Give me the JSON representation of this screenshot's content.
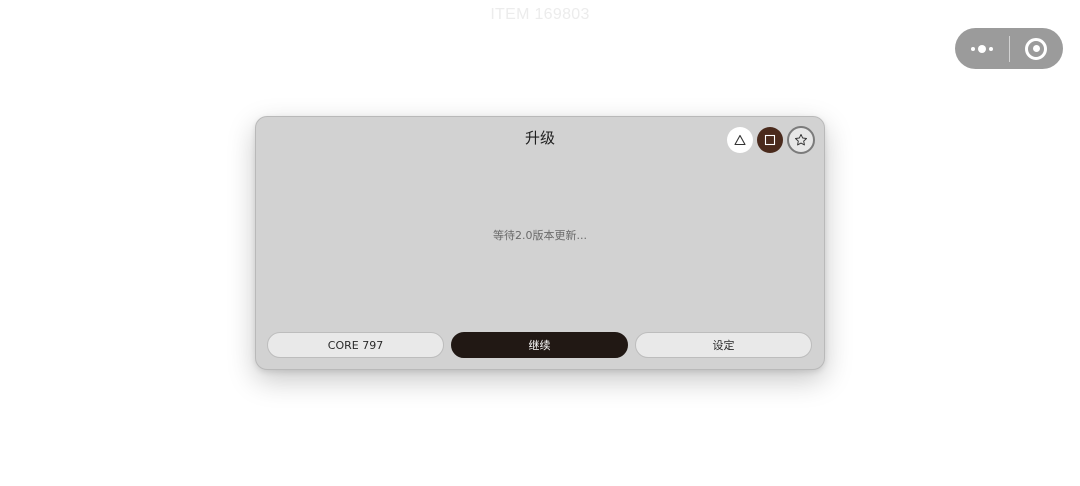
{
  "page": {
    "title": "ITEM 169803"
  },
  "capsule": {
    "more_icon": "more-dots-icon",
    "close_icon": "record-target-icon"
  },
  "dialog": {
    "title": "升级",
    "message": "等待2.0版本更新...",
    "window_controls": [
      {
        "icon": "triangle-icon"
      },
      {
        "icon": "square-icon"
      },
      {
        "icon": "star-icon"
      }
    ],
    "buttons": {
      "left": "CORE 797",
      "primary": "继续",
      "right": "设定"
    }
  },
  "colors": {
    "dialog_bg": "#d2d2d2",
    "primary_button": "#211814",
    "square_control": "#4a2a1c",
    "capsule_bg": "#9b9b9b"
  }
}
